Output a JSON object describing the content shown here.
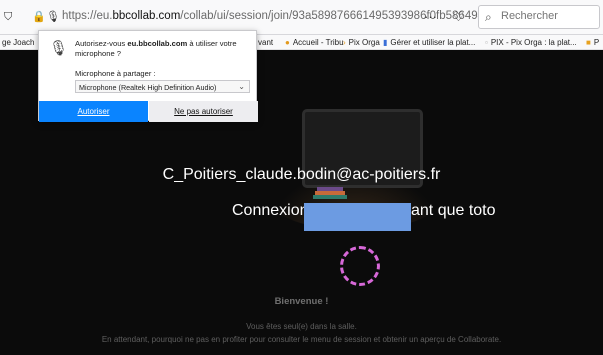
{
  "browser": {
    "url_prefix": "https://eu.",
    "url_domain": "bbcollab.com",
    "url_path": "/collab/ui/session/join/93a589876661495393986f0fb586494e",
    "more": "···",
    "pocket_icon": "pocket-icon",
    "star_icon": "star-icon",
    "search_placeholder": "Rechercher"
  },
  "bookmarks": [
    {
      "label": "ge Joach",
      "icon": ""
    },
    {
      "label": "vant",
      "icon": ""
    },
    {
      "label": "Accueil - Tribu",
      "icon": "tribu-icon"
    },
    {
      "label": "Pix Orga",
      "icon": "chevron-icon"
    },
    {
      "label": "Gérer et utiliser la plat...",
      "icon": "bars-icon"
    },
    {
      "label": "PIX - Pix Orga : la plat...",
      "icon": "page-icon"
    },
    {
      "label": "P",
      "icon": "folder-icon"
    }
  ],
  "permission": {
    "question_prefix": "Autorisez-vous ",
    "question_domain": "eu.bbcollab.com",
    "question_suffix": " à utiliser votre microphone ?",
    "share_label": "Microphone à partager :",
    "share_label_underline": "M",
    "selected_device": "Microphone (Realtek High Definition Audio)",
    "allow_label": "Autoriser",
    "deny_label": "Ne pas autoriser"
  },
  "session": {
    "user_line": "C_Poitiers_claude.bodin@ac-poitiers.fr",
    "connexion_prefix": "Connexion",
    "connexion_suffix": "ant que toto",
    "welcome": "Bienvenue !",
    "alone": "Vous êtes seul(e) dans la salle.",
    "waiting": "En attendant, pourquoi ne pas en profiter pour consulter le menu de session et obtenir un aperçu de Collaborate."
  }
}
